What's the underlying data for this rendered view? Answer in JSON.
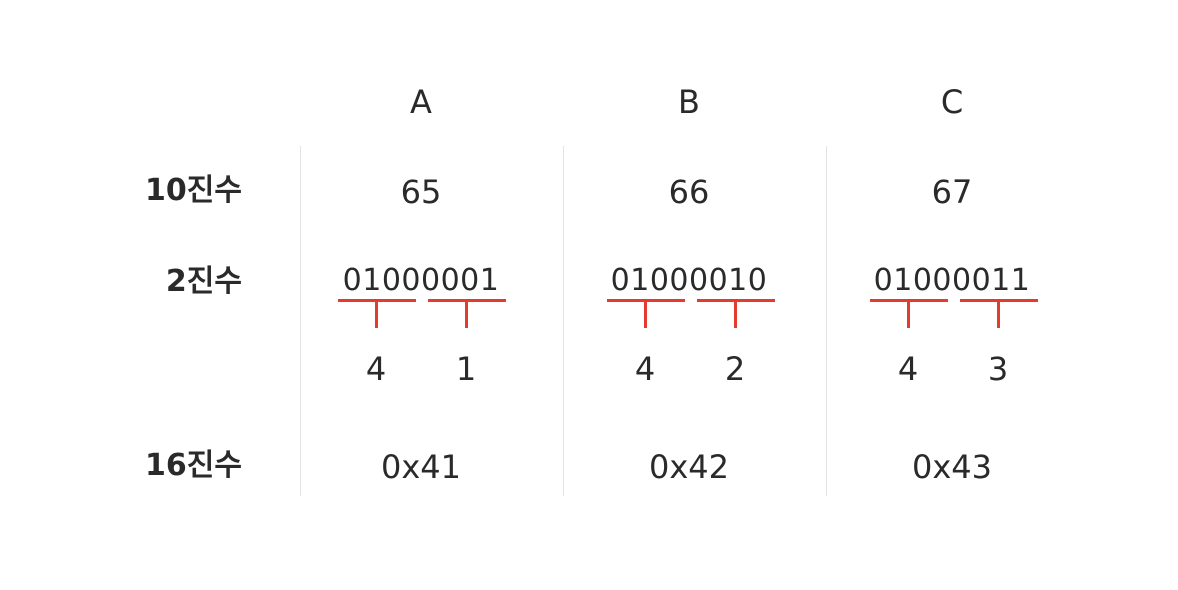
{
  "row_labels": {
    "decimal": "10진수",
    "binary": "2진수",
    "hex": "16진수"
  },
  "columns": [
    {
      "letter": "A",
      "decimal": "65",
      "binary": "01000001",
      "high_nibble": "4",
      "low_nibble": "1",
      "hex": "0x41"
    },
    {
      "letter": "B",
      "decimal": "66",
      "binary": "01000010",
      "high_nibble": "4",
      "low_nibble": "2",
      "hex": "0x42"
    },
    {
      "letter": "C",
      "decimal": "67",
      "binary": "01000011",
      "high_nibble": "4",
      "low_nibble": "3",
      "hex": "0x43"
    }
  ],
  "colors": {
    "bracket": "#e53a2e",
    "text": "#2a2a2a",
    "divider": "#e3e3e3"
  }
}
